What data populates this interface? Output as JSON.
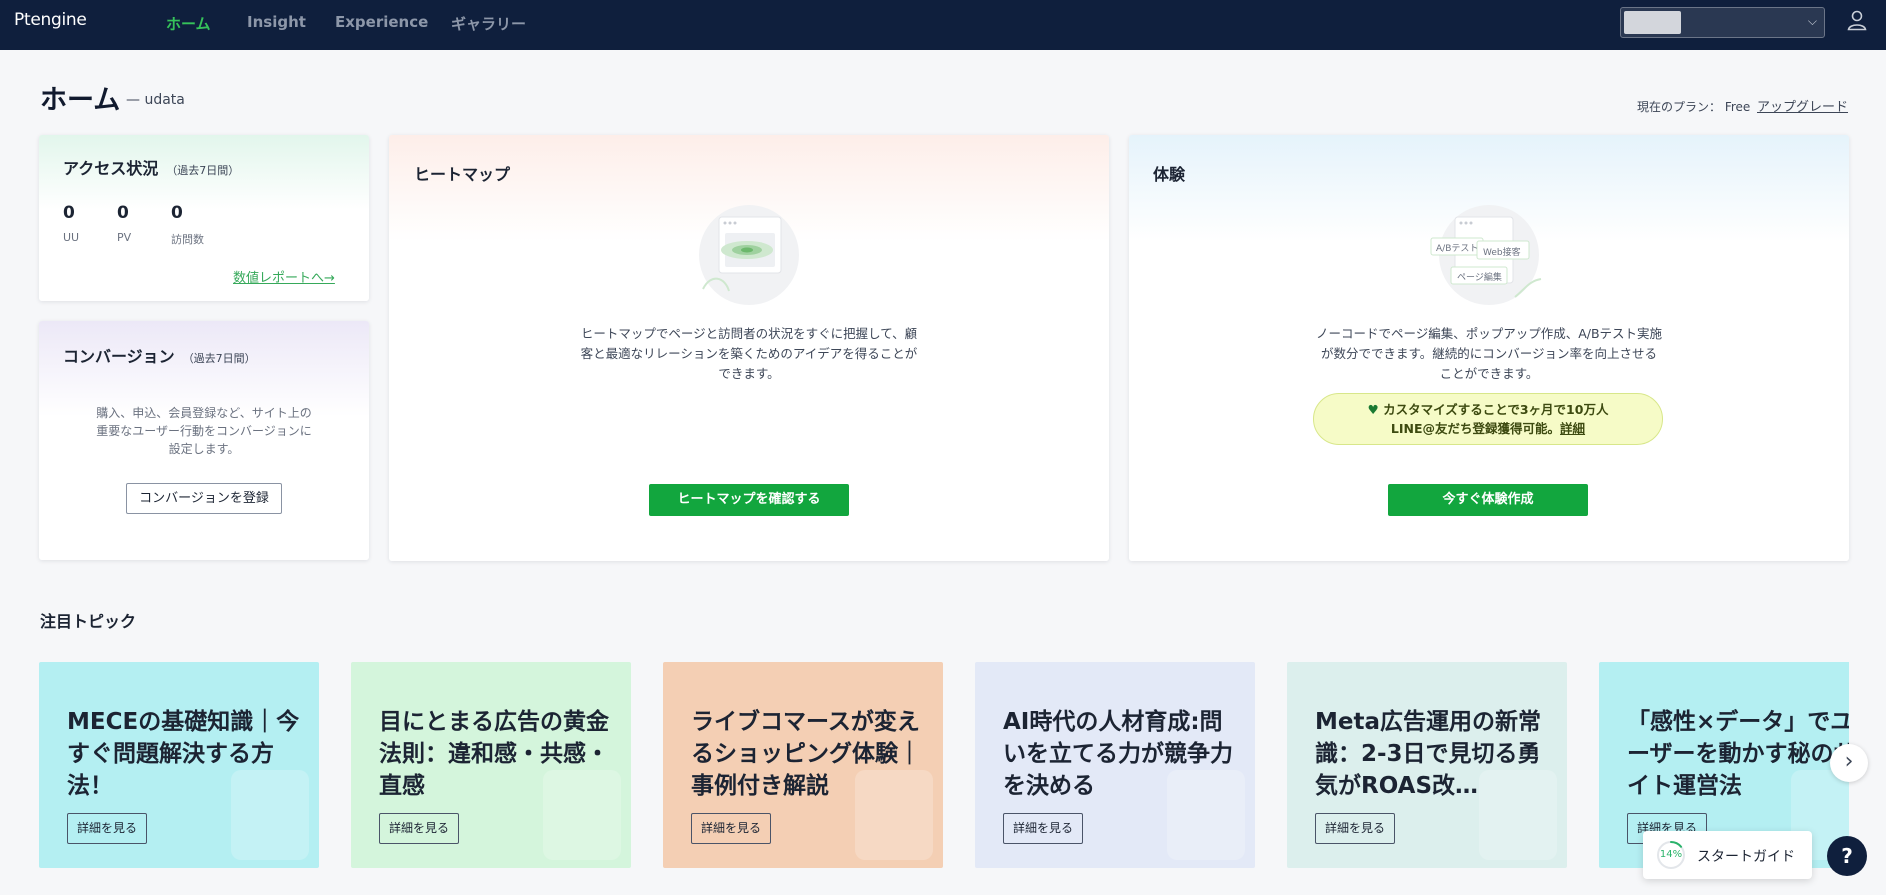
{
  "nav": {
    "logo": "Ptengine",
    "items": [
      {
        "label": "ホーム",
        "active": true
      },
      {
        "label": "Insight",
        "active": false
      },
      {
        "label": "Experience",
        "active": false
      },
      {
        "label": "ギャラリー",
        "active": false
      }
    ]
  },
  "header": {
    "title": "ホーム",
    "subtitle": "— udata",
    "plan_label": "現在のプラン：  Free",
    "upgrade_label": "アップグレード"
  },
  "access": {
    "title": "アクセス状況",
    "period": "（過去7日間）",
    "metrics": [
      {
        "value": "0",
        "label": "UU"
      },
      {
        "value": "0",
        "label": "PV"
      },
      {
        "value": "0",
        "label": "訪問数"
      }
    ],
    "report_link": "数値レポートへ→"
  },
  "conversion": {
    "title": "コンバージョン",
    "period": "（過去7日間）",
    "description_lines": [
      "購入、申込、会員登録など、サイト上の",
      "重要なユーザー行動をコンバージョンに",
      "設定します。"
    ],
    "button": "コンバージョンを登録"
  },
  "heatmap": {
    "title": "ヒートマップ",
    "description_lines": [
      "ヒートマップでページと訪問者の状況をすぐに把握して、顧",
      "客と最適なリレーションを築くためのアイデアを得ることが",
      "できます。"
    ],
    "button": "ヒートマップを確認する"
  },
  "experience": {
    "title": "体験",
    "illustration_tags": [
      "A/Bテスト",
      "Web接客",
      "ページ編集"
    ],
    "description_lines": [
      "ノーコードでページ編集、ポップアップ作成、A/Bテスト実施",
      "が数分でできます。継続的にコンバージョン率を向上させる",
      "ことができます。"
    ],
    "promo_line1": "カスタマイズすることで3ヶ月で10万人",
    "promo_line2": "LINE@友だち登録獲得可能。",
    "promo_link": "詳細",
    "button": "今すぐ体験作成"
  },
  "topics": {
    "section_title": "注目トピック",
    "button_label": "詳細を見る",
    "items": [
      {
        "title": "MECEの基礎知識｜今すぐ問題解決する方法！",
        "color": "#b4eff2"
      },
      {
        "title": "目にとまる広告の黄金法則：違和感・共感・直感",
        "color": "#d4f5dc"
      },
      {
        "title": "ライブコマースが変えるショッピング体験｜事例付き解説",
        "color": "#f4cfb4"
      },
      {
        "title": "AI時代の人材育成:問いを立てる力が競争力を決める",
        "color": "#e3e9f7"
      },
      {
        "title": "Meta広告運用の新常識：2-3日で見切る勇気がROAS改…",
        "color": "#dcefed"
      },
      {
        "title": "「感性×データ」でユーザーを動かす秘のサイト運営法",
        "color": "#b4eff2"
      }
    ]
  },
  "guide": {
    "percent": "14%",
    "progress": 0.14,
    "label": "スタートガイド"
  },
  "help_label": "?",
  "colors": {
    "nav_bg": "#0f1f3d",
    "accent_green": "#12a63e",
    "nav_active": "#36c35a"
  }
}
